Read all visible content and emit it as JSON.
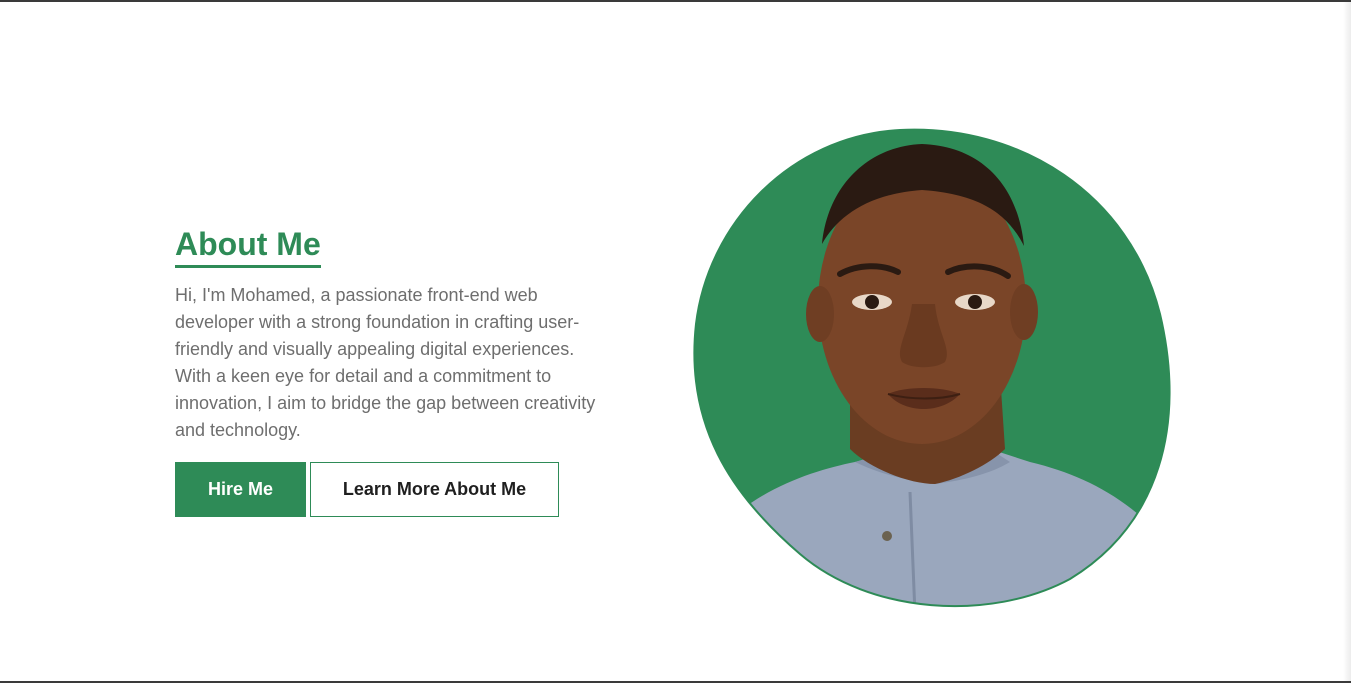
{
  "about": {
    "title": "About Me",
    "body": "Hi, I'm Mohamed, a passionate front-end web developer with a strong foundation in crafting user-friendly and visually appealing digital experiences. With a keen eye for detail and a commitment to innovation, I aim to bridge the gap between creativity and technology.",
    "buttons": {
      "hire_label": "Hire Me",
      "learn_label": "Learn More About Me"
    }
  },
  "colors": {
    "accent": "#2e8b57",
    "body_text": "#6e6e6e",
    "background": "#ffffff"
  },
  "portrait": {
    "icon": "profile-photo",
    "shape": "organic-blob"
  }
}
